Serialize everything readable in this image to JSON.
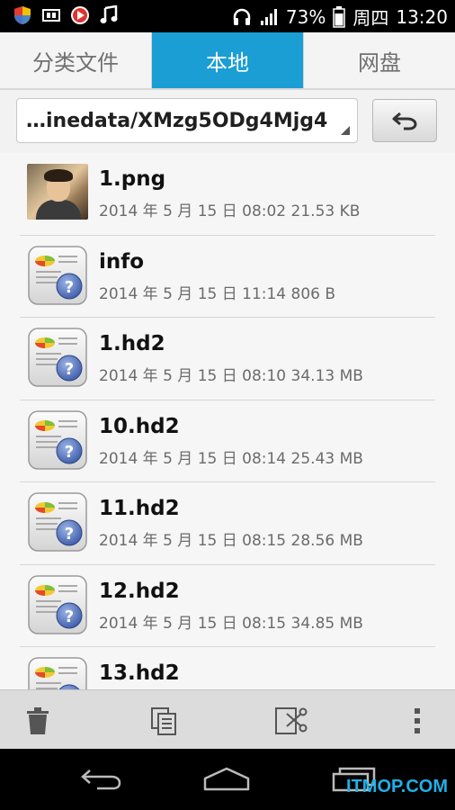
{
  "status_bar": {
    "battery": "73%",
    "weekday": "周四",
    "time": "13:20",
    "icons": [
      "shield-icon",
      "media-icon",
      "play-icon",
      "music-icon",
      "headphones-icon",
      "signal-icon",
      "battery-icon"
    ]
  },
  "tabs": [
    {
      "label": "分类文件"
    },
    {
      "label": "本地"
    },
    {
      "label": "网盘"
    }
  ],
  "path": {
    "value": "…inedata/XMzg5ODg4Mjg4"
  },
  "files": [
    {
      "name": "1.png",
      "meta": "2014 年 5 月 15 日 08:02 21.53 KB",
      "icon": "image-thumbnail"
    },
    {
      "name": "info",
      "meta": "2014 年 5 月 15 日 11:14 806 B",
      "icon": "unknown-file-icon"
    },
    {
      "name": "1.hd2",
      "meta": "2014 年 5 月 15 日 08:10 34.13 MB",
      "icon": "unknown-file-icon"
    },
    {
      "name": "10.hd2",
      "meta": "2014 年 5 月 15 日 08:14 25.43 MB",
      "icon": "unknown-file-icon"
    },
    {
      "name": "11.hd2",
      "meta": "2014 年 5 月 15 日 08:15 28.56 MB",
      "icon": "unknown-file-icon"
    },
    {
      "name": "12.hd2",
      "meta": "2014 年 5 月 15 日 08:15 34.85 MB",
      "icon": "unknown-file-icon"
    },
    {
      "name": "13.hd2",
      "meta": "",
      "icon": "unknown-file-icon"
    }
  ],
  "toolbar": {
    "icons": [
      "trash-icon",
      "copy-icon",
      "cut-icon",
      "more-icon"
    ]
  },
  "navbar": {
    "icons": [
      "back-icon",
      "home-icon",
      "recent-apps-icon"
    ]
  },
  "watermark": "ITMOP.COM",
  "colors": {
    "accent": "#1a9ed4",
    "watermark": "#20b0e8"
  }
}
